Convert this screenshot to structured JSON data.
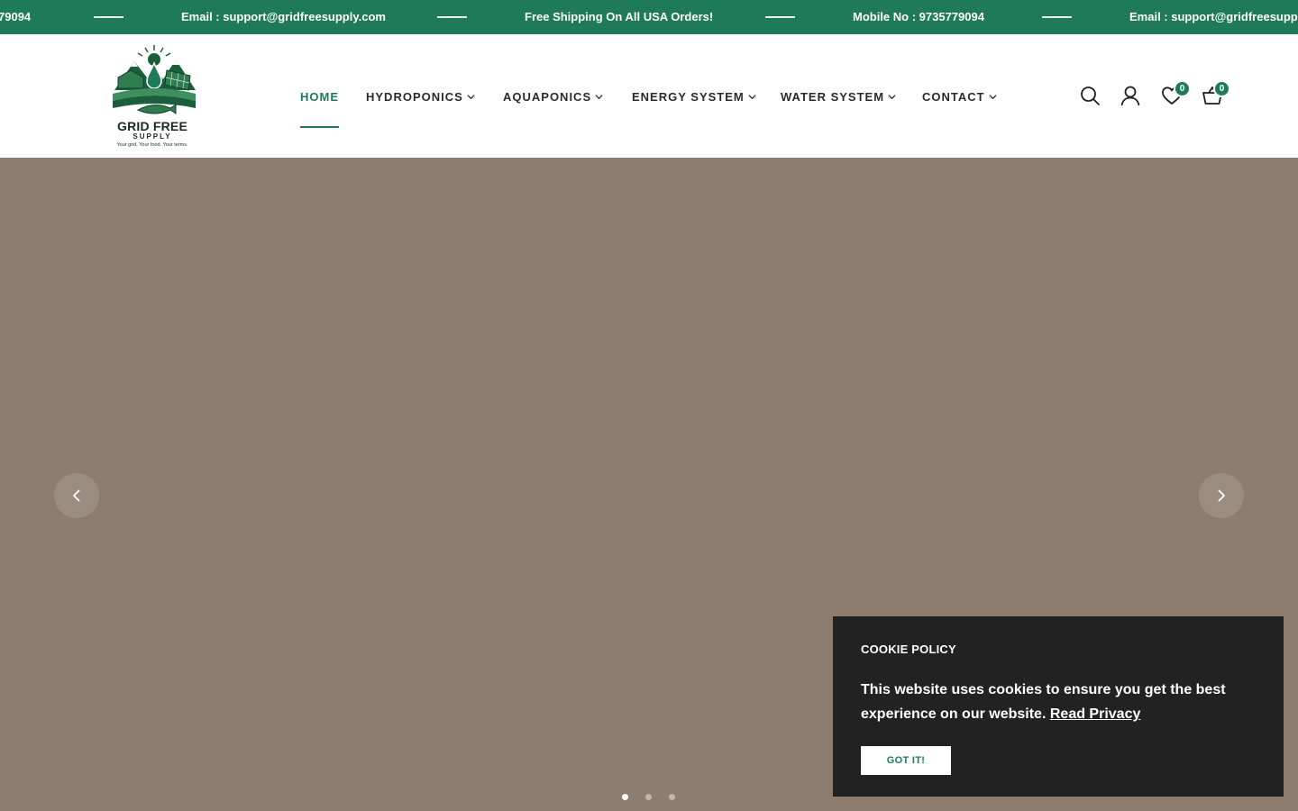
{
  "announcement": {
    "items": [
      "79094",
      "Email : support@gridfreesupply.com",
      "Free Shipping On All USA Orders!",
      "Mobile No : 9735779094",
      "Email : support@gridfreesupply"
    ]
  },
  "logo": {
    "title": "GRID FREE",
    "subtitle": "SUPPLY",
    "tagline": "Your grid. Your food. Your terms."
  },
  "nav": {
    "items": [
      {
        "label": "HOME",
        "active": true,
        "dropdown": false
      },
      {
        "label": "HYDROPONICS",
        "active": false,
        "dropdown": true
      },
      {
        "label": "AQUAPONICS",
        "active": false,
        "dropdown": true
      },
      {
        "label": "ENERGY SYSTEM",
        "active": false,
        "dropdown": true
      },
      {
        "label": "WATER SYSTEM",
        "active": false,
        "dropdown": true
      },
      {
        "label": "CONTACT",
        "active": false,
        "dropdown": true
      }
    ]
  },
  "header_icons": {
    "search": "search-icon",
    "account": "user-icon",
    "wishlist": "heart-icon",
    "cart": "cart-icon",
    "wishlist_count": "0",
    "cart_count": "0"
  },
  "slider": {
    "slide_count": 3,
    "active_index": 0
  },
  "cookie": {
    "title": "COOKIE POLICY",
    "text": "This website uses cookies to ensure you get the best experience on our website.",
    "link": "Read Privacy",
    "button": "GOT IT!"
  },
  "colors": {
    "brand": "#1f7a57",
    "hero_bg": "#8e7d6f",
    "popup_bg": "#222222"
  }
}
